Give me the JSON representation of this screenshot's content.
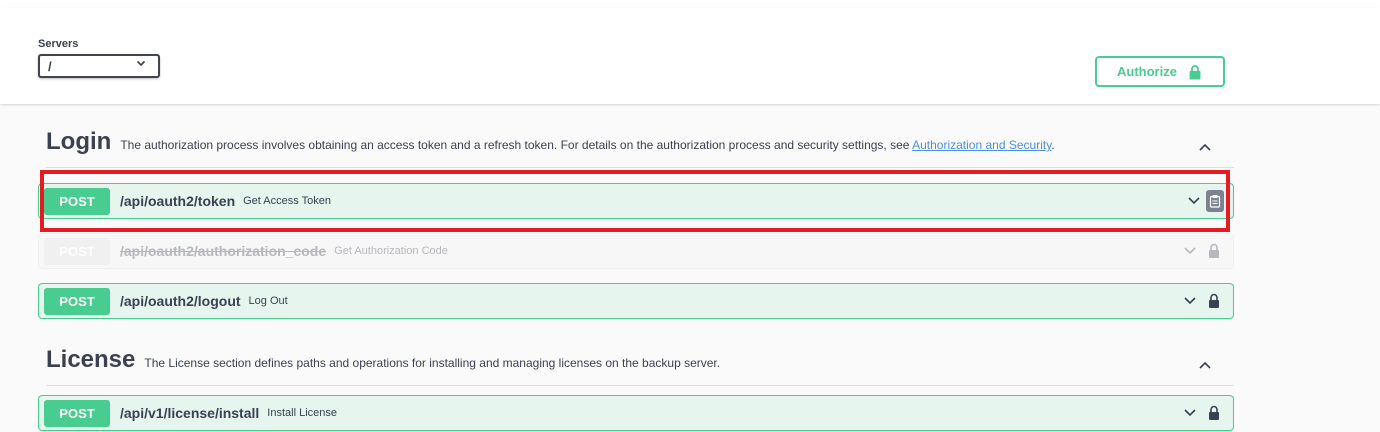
{
  "servers": {
    "label": "Servers",
    "selected": "/"
  },
  "authorize": {
    "label": "Authorize",
    "icon": "lock-icon"
  },
  "colors": {
    "post": "#49cc90",
    "highlight": "#e31b23",
    "link": "#4990e2"
  },
  "sections": [
    {
      "title": "Login",
      "description": "The authorization process involves obtaining an access token and a refresh token. For details on the authorization process and security settings, see ",
      "link": "Authorization and Security",
      "description_end": ".",
      "operations": [
        {
          "method": "POST",
          "path": "/api/oauth2/token",
          "summary": "Get Access Token",
          "deprecated": false
        },
        {
          "method": "POST",
          "path": "/api/oauth2/authorization_code",
          "summary": "Get Authorization Code",
          "deprecated": true
        },
        {
          "method": "POST",
          "path": "/api/oauth2/logout",
          "summary": "Log Out",
          "deprecated": false
        }
      ]
    },
    {
      "title": "License",
      "description": "The License section defines paths and operations for installing and managing licenses on the backup server.",
      "operations": [
        {
          "method": "POST",
          "path": "/api/v1/license/install",
          "summary": "Install License",
          "deprecated": false
        }
      ]
    }
  ]
}
